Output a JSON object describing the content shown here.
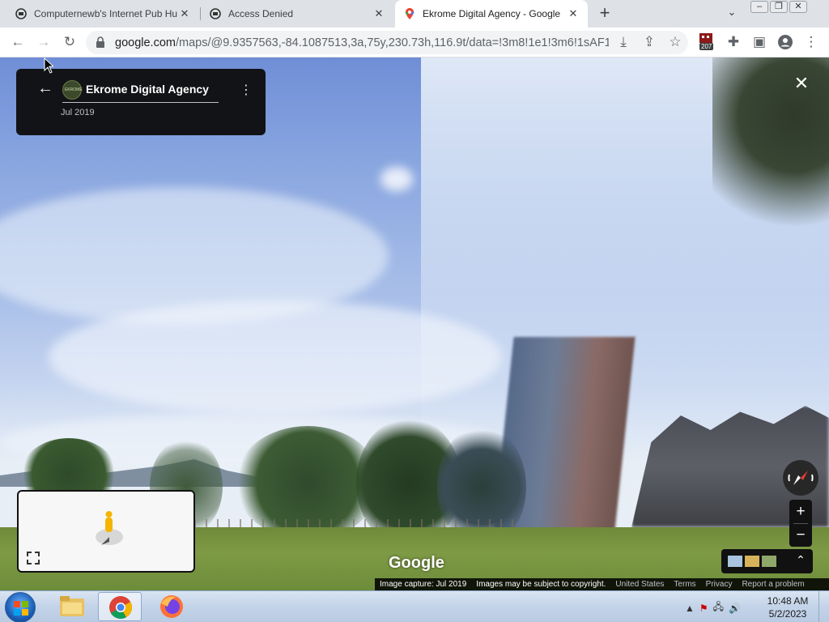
{
  "browser": {
    "tabs": [
      {
        "title": "Computernewb's Internet Pub Hu",
        "active": false,
        "icon": "computernewb-icon"
      },
      {
        "title": "Access Denied",
        "active": false,
        "icon": "computernewb-icon"
      },
      {
        "title": "Ekrome Digital Agency - Google",
        "active": true,
        "icon": "google-maps-icon"
      }
    ],
    "new_tab_label": "+",
    "url_host": "google.com",
    "url_rest": "/maps/@9.9357563,-84.1087513,3a,75y,230.73h,116.9t/data=!3m8!1e1!3m6!1sAF1Qi...",
    "extension_badge": "207"
  },
  "streetview": {
    "place_title": "Ekrome Digital Agency",
    "logo_text": "EKROME",
    "date": "Jul 2019",
    "google_logo": "Google",
    "footer": {
      "capture": "Image capture: Jul 2019",
      "copyright": "Images may be subject to copyright.",
      "region": "United States",
      "terms": "Terms",
      "privacy": "Privacy",
      "report": "Report a problem"
    },
    "zoom_in": "+",
    "zoom_out": "−"
  },
  "taskbar": {
    "time": "10:48 AM",
    "date": "5/2/2023"
  }
}
